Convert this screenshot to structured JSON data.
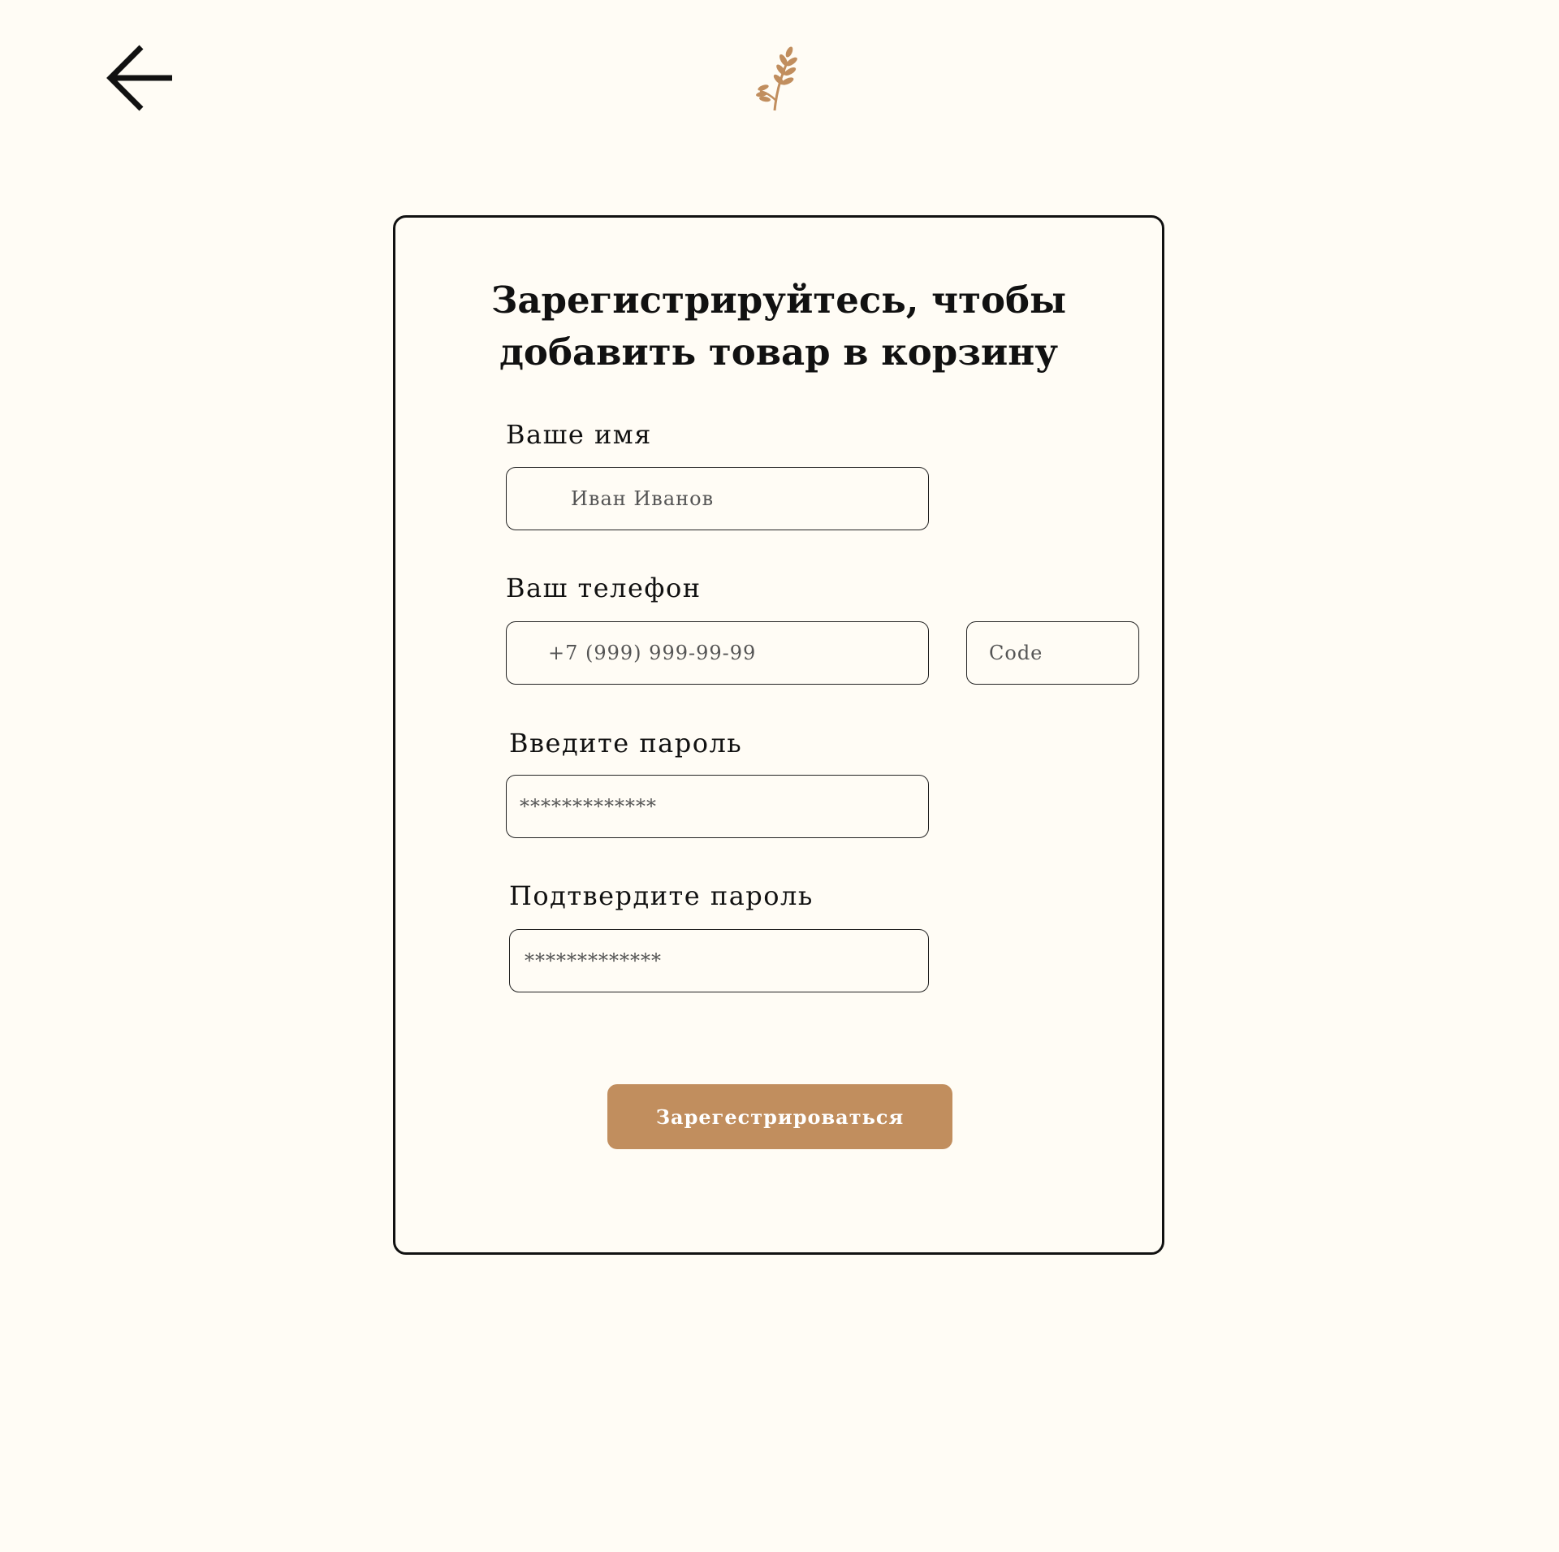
{
  "header": {
    "back_icon": "arrow-left-icon",
    "logo_icon": "wheat-sprig-logo",
    "logo_color": "#c18e5e"
  },
  "form": {
    "title_line1": "Зарегистрируйтесь, чтобы",
    "title_line2": "добавить товар в корзину",
    "name_label": "Ваше имя",
    "name_placeholder": "Иван Иванов",
    "phone_label": "Ваш телефон",
    "phone_placeholder": "+7 (999) 999-99-99",
    "code_placeholder": "Code",
    "password_label": "Введите пароль",
    "password_placeholder": "*************",
    "confirm_label": "Подтвердите пароль",
    "confirm_placeholder": "*************",
    "submit_label": "Зарегестрироваться"
  },
  "colors": {
    "background": "#fffcf5",
    "accent": "#c18e5e",
    "border": "#111111",
    "text": "#111111"
  }
}
